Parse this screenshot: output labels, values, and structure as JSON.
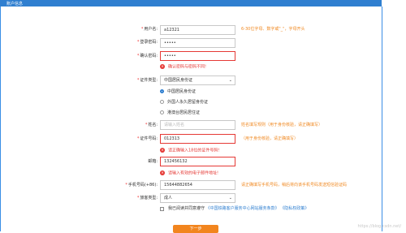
{
  "header": {
    "title": "账户信息"
  },
  "form": {
    "username": {
      "label": "用户名:",
      "value": "a12321",
      "hint": "6-30位字母、数字或\"_\"，字母开头"
    },
    "password": {
      "label": "登录密码:",
      "value": "•••••"
    },
    "confirm": {
      "label": "确认密码:",
      "value": "•••••",
      "error": "确认密码与密码不同!"
    },
    "id_type": {
      "label": "证件类型:",
      "selected": "中国居民身份证",
      "options": [
        "中国居民身份证",
        "外国人永久居留身份证",
        "港澳台居民居住证"
      ],
      "selected_index": 0
    },
    "name": {
      "label": "姓名:",
      "placeholder": "请输入姓名",
      "hint": "姓名填写规则（用于身份核验，请正确填写）"
    },
    "id_number": {
      "label": "证件号码:",
      "value": "012313",
      "hint": "（用于身份核验，请正确填写）",
      "error": "请正确输入18位的证件号码!"
    },
    "email": {
      "label": "邮箱:",
      "value": "132456132",
      "error": "请输入有效的电子邮件地址!"
    },
    "phone": {
      "label": "手机号码(+86):",
      "value": "15644882654",
      "hint": "请正确填写手机号码，稍后将向该手机号码发送短信验证码"
    },
    "passenger_type": {
      "label": "旅客类型:",
      "selected": "成人"
    },
    "agreement": {
      "prefix": "我已阅读并同意遵守",
      "link1": "《中国铁路客户服务中心网站服务条款》",
      "link2": "《隐私权政策》",
      "checked": false
    },
    "submit_label": "下一步"
  },
  "watermark": "https://blog.csdn.net/"
}
